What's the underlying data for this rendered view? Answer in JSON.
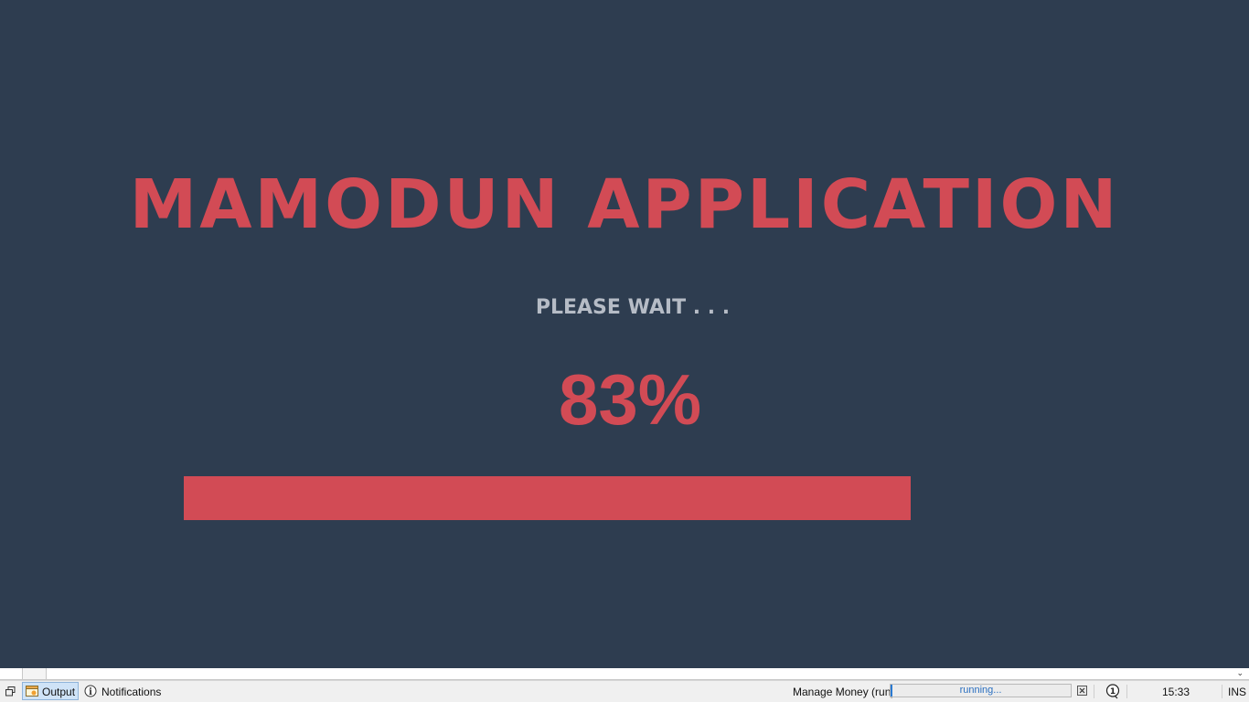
{
  "splash": {
    "title": "MAMODUN APPLICATION",
    "subtitle": "PLEASE WAIT . . .",
    "percent_text": "83%",
    "progress_fraction": 0.83,
    "accent_color": "#d24b55",
    "background_color": "#2e3d50",
    "subtitle_color": "#b6bcc6"
  },
  "statusbar": {
    "restore_icon": "restore-window-icon",
    "tabs": [
      {
        "label": "Output",
        "icon": "output-window-icon",
        "selected": true
      },
      {
        "label": "Notifications",
        "icon": "info-icon",
        "selected": false
      }
    ],
    "task_name": "Manage Money (run)",
    "task_status": "running...",
    "cancel_icon": "cancel-task-icon",
    "notification_icon": "info-balloon-icon",
    "clock": "15:33",
    "insert_mode": "INS"
  }
}
